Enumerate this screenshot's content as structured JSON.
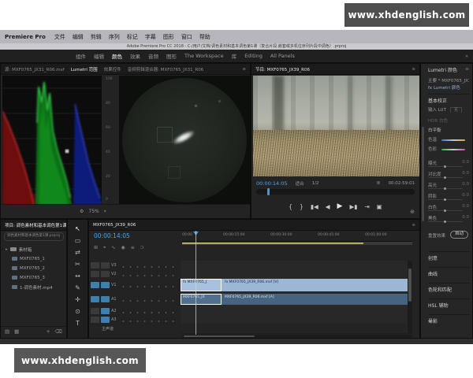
{
  "watermarks": {
    "top": "www.xhdenglish.com",
    "bottom": "www.xhdenglish.com"
  },
  "menubar": {
    "app": "Premiere Pro",
    "items": [
      "文件",
      "编辑",
      "剪辑",
      "序列",
      "标记",
      "字幕",
      "图形",
      "窗口",
      "帮助"
    ]
  },
  "titlebar": {
    "path": "Adobe Premiere Pro CC 2018 - C:/用户/文档/调色素材和基本调色第1课（复合片段.嵌套或多机位序列片段中调色）.prproj"
  },
  "workspace": {
    "tabs": [
      "组件",
      "编辑",
      "颜色",
      "效果",
      "音频",
      "图形",
      "The Workspace",
      "库",
      "Editing",
      "All Panels"
    ],
    "overflow": "»"
  },
  "scopes": {
    "tabs": [
      "源: MXF0765_JX31_R06.mxf",
      "Lumetri 范围",
      "效果控件",
      "音频剪辑混合器: MXF0765_JX31_R06"
    ],
    "scale_labels": [
      "100",
      "80",
      "60",
      "40",
      "20",
      "0"
    ],
    "settings_icon": "⚙",
    "zoom_level": "75%"
  },
  "program": {
    "tab": "节目: MXF0765_JX39_R06",
    "timecode": "00:00:14:05",
    "fit": "适合",
    "resolution": "1/2",
    "settings_icon": "⚙",
    "duration": "00:02:59:01",
    "transport": {
      "mark_in": "{",
      "mark_out": "}",
      "step_back": "▮◀",
      "prev": "◀",
      "play": "▶",
      "next": "▶▮",
      "lift": "⇥",
      "export_frame": "▣",
      "add": "⊕"
    }
  },
  "lumetri": {
    "tab": "Lumetri 颜色",
    "menu_icon": "≡",
    "clip_row": "主要 * MXF0765_JX39_R06",
    "effect_row": "fx  Lumetri 颜色",
    "section_basic": "基本校正",
    "input_lut_label": "输入 LUT",
    "input_lut_value": "无",
    "hdr_white": "HDR 白色",
    "white_balance_label": "白平衡",
    "temp_label": "色温",
    "tint_label": "色彩",
    "params": [
      {
        "label": "曝光",
        "value": "0.0"
      },
      {
        "label": "对比度",
        "value": "0.0"
      },
      {
        "label": "高光",
        "value": "0.0"
      },
      {
        "label": "阴影",
        "value": "0.0"
      },
      {
        "label": "白色",
        "value": "0.0"
      },
      {
        "label": "黑色",
        "value": "0.0"
      }
    ],
    "reset_button": "重置效果",
    "auto_button": "自动",
    "sections": [
      "创意",
      "曲线",
      "色轮和匹配",
      "HSL 辅助",
      "晕影"
    ]
  },
  "project": {
    "tab": "项目: 调色素材和基本调色第1课",
    "subtext": "调色素材和基本调色第1课.prproj",
    "items": [
      "素材箱",
      "MXF0765_1",
      "MXF0765_2",
      "MXF0765_3",
      "1-调色素材.mp4"
    ],
    "footer_icons": {
      "list_view": "▤",
      "icon_view": "▦",
      "new_bin": "+",
      "delete": "⌫"
    }
  },
  "tools": [
    {
      "name": "selection-tool",
      "glyph": "↖"
    },
    {
      "name": "track-select-tool",
      "glyph": "▭"
    },
    {
      "name": "ripple-edit-tool",
      "glyph": "⇄"
    },
    {
      "name": "razor-tool",
      "glyph": "✂"
    },
    {
      "name": "slip-tool",
      "glyph": "↔"
    },
    {
      "name": "pen-tool",
      "glyph": "✎"
    },
    {
      "name": "hand-tool",
      "glyph": "✛"
    },
    {
      "name": "zoom-tool",
      "glyph": "⊙"
    },
    {
      "name": "type-tool",
      "glyph": "T"
    }
  ],
  "timeline": {
    "tab": "MXF0765_JX39_R06",
    "timecode": "00:00:14:05",
    "toolbar_icons": [
      "⊞",
      "⌖",
      "∿",
      "◉",
      "≡",
      "⊃"
    ],
    "ruler_labels": [
      "00:00",
      "00:00:15:00",
      "00:00:30:00",
      "00:00:45:00",
      "00:01:00:00"
    ],
    "video_tracks": [
      "V3",
      "V2",
      "V1"
    ],
    "audio_tracks": [
      "A1",
      "A2",
      "A3"
    ],
    "master_label": "主声道",
    "video_clip_head": "fx MXF0765_J",
    "video_clip_label": "fx MXF0765_JX39_R06.mxf [V]",
    "audio_clip_head": "MXF0765_JX",
    "audio_clip_label": "MXF0765_JX39_R06.mxf [A]"
  },
  "colors": {
    "accent": "#2d8ceb",
    "timecode_blue": "#4fa3e3",
    "clip_video": "#9cb7d6",
    "clip_audio": "#47637f",
    "work_area": "#b3ab52"
  }
}
